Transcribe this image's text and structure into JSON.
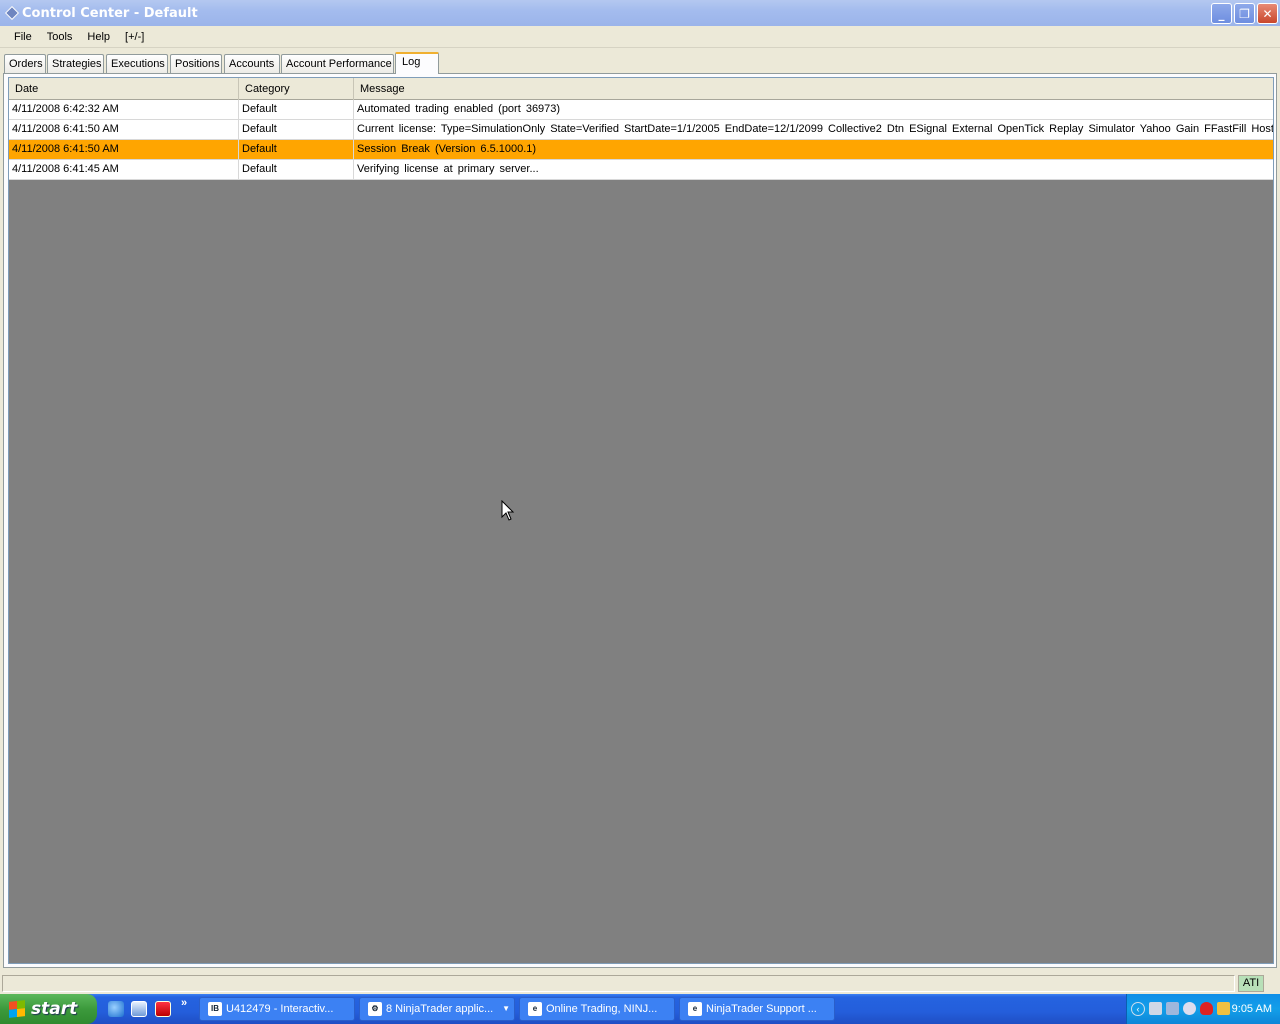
{
  "window": {
    "title": "Control Center - Default",
    "controls": {
      "minimize": "_",
      "maximize": "❐",
      "close": "✕"
    }
  },
  "menu": [
    "File",
    "Tools",
    "Help",
    "[+/-]"
  ],
  "tabs": [
    "Orders",
    "Strategies",
    "Executions",
    "Positions",
    "Accounts",
    "Account Performance",
    "Log"
  ],
  "active_tab": "Log",
  "log": {
    "columns": [
      "Date",
      "Category",
      "Message"
    ],
    "rows": [
      {
        "date": "4/11/2008 6:42:32 AM",
        "category": "Default",
        "message": "Automated trading enabled (port 36973)",
        "highlight": false
      },
      {
        "date": "4/11/2008 6:41:50 AM",
        "category": "Default",
        "message": "Current license: Type=SimulationOnly State=Verified StartDate=1/1/2005 EndDate=12/1/2099 Collective2 Dtn ESignal External OpenTick Replay Simulator Yahoo Gain FFastFill Host",
        "highlight": false
      },
      {
        "date": "4/11/2008 6:41:50 AM",
        "category": "Default",
        "message": "Session Break (Version 6.5.1000.1)",
        "highlight": true
      },
      {
        "date": "4/11/2008 6:41:45 AM",
        "category": "Default",
        "message": "Verifying license at primary server...",
        "highlight": false
      }
    ],
    "highlight_color": "#ffa500"
  },
  "status": {
    "connection": "ATI"
  },
  "taskbar": {
    "start_label": "start",
    "quick_launch": [
      "ie-icon",
      "outlook-express-icon",
      "app-icon"
    ],
    "tasks": [
      {
        "label": "U412479 - Interactiv...",
        "icon": "IB"
      },
      {
        "label": "8 NinjaTrader applic...",
        "icon": "⚙",
        "has_dropdown": true
      },
      {
        "label": "Online Trading, NINJ...",
        "icon": "e"
      },
      {
        "label": "NinjaTrader Support ...",
        "icon": "e"
      }
    ],
    "clock": "9:05 AM"
  }
}
